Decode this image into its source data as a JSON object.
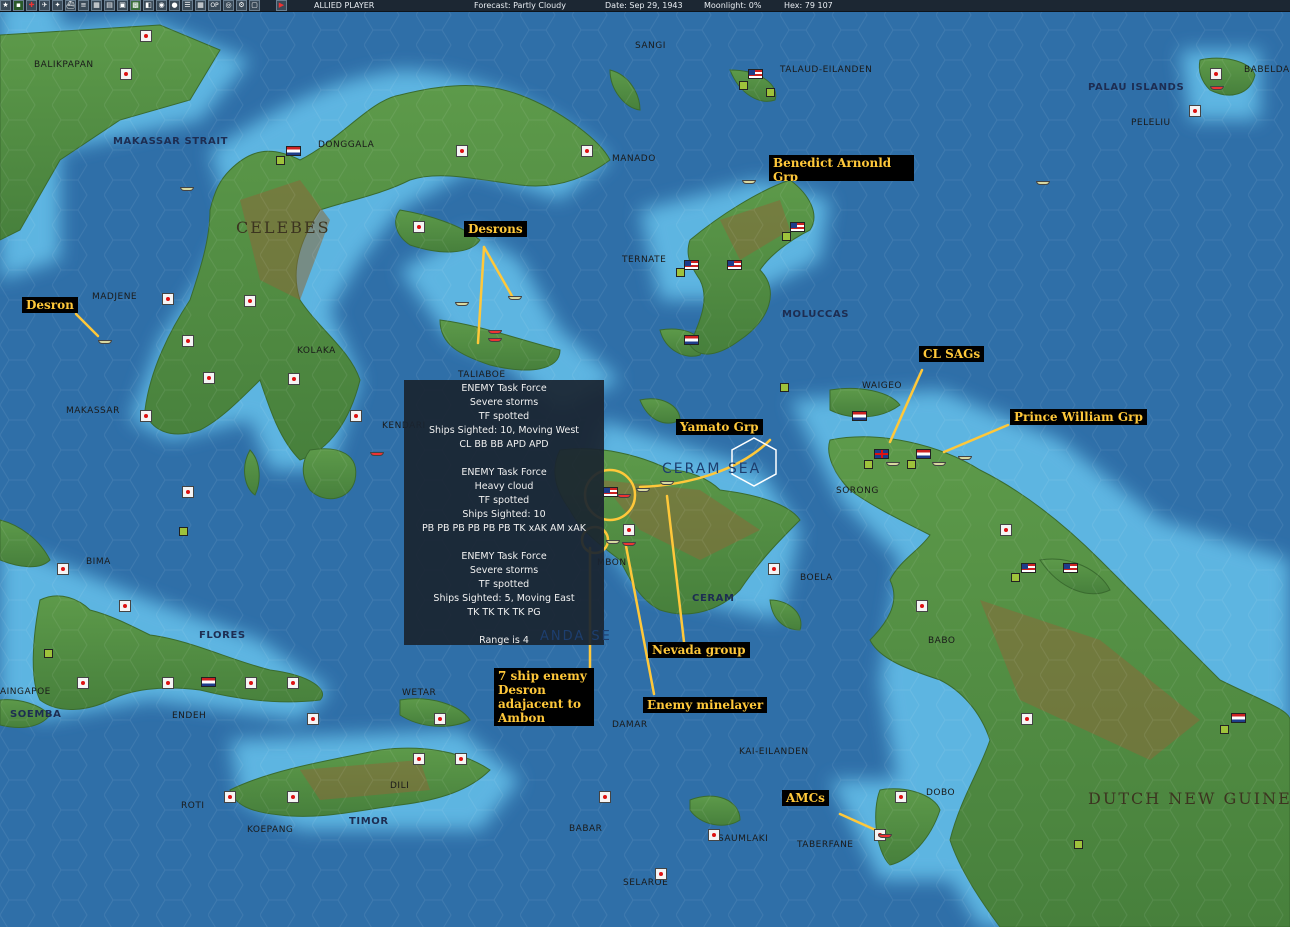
{
  "topbar": {
    "player": "ALLIED PLAYER",
    "forecast": "Forecast: Partly Cloudy",
    "date": "Date: Sep 29, 1943",
    "moonlight": "Moonlight: 0%",
    "hex": "Hex: 79 107",
    "button_op": "OP"
  },
  "map_labels": {
    "balikpapan": "BALIKPAPAN",
    "makassar_strait": "MAKASSAR STRAIT",
    "donggala": "DONGGALA",
    "sangi": "SANGI",
    "manado": "MANADO",
    "talaud": "TALAUD-EILANDEN",
    "palau": "PALAU ISLANDS",
    "babeldaob": "BABELDAC",
    "peleliu": "PELELIU",
    "celebes": "CELEBES",
    "madjene": "MADJENE",
    "ternate": "TERNATE",
    "moluccas": "MOLUCCAS",
    "kolaka": "KOLAKA",
    "taliaboe": "TALIABOE",
    "makassar": "MAKASSAR",
    "kendari": "KENDARI",
    "waigeo": "WAIGEO",
    "ceram_sea": "CERAM SEA",
    "sorong": "SORONG",
    "bima": "BIMA",
    "ambon": "MBON",
    "boela": "BOELA",
    "ceram": "CERAM",
    "flores": "FLORES",
    "babo": "BABO",
    "banda_sea": "ANDA SE",
    "waingapoe": "AINGAPOE",
    "soemba": "SOEMBA",
    "endeh": "ENDEH",
    "wetar": "WETAR",
    "damar": "DAMAR",
    "kai": "KAI-EILANDEN",
    "dili": "DILI",
    "roti": "ROTI",
    "timor": "TIMOR",
    "dobo": "DOBO",
    "dutch_new_guinea": "DUTCH NEW GUINEA",
    "koepang": "KOEPANG",
    "babar": "BABAR",
    "saumlaki": "SAUMLAKI",
    "taberfane": "TABERFANE",
    "selaroe": "SELAROE"
  },
  "annotations": {
    "benedict": "Benedict Arnonld Grp",
    "desrons": "Desrons",
    "desron": "Desron",
    "cl_sags": "CL SAGs",
    "prince_william": "Prince William Grp",
    "yamato": "Yamato Grp",
    "nevada": "Nevada group",
    "minelayer": "Enemy minelayer",
    "desron7": "7 ship enemy Desron adajacent to Ambon",
    "amcs": "AMCs"
  },
  "popup": {
    "lines": [
      "ENEMY Task Force",
      "Severe storms",
      "TF spotted",
      "Ships Sighted: 10, Moving West",
      "CL BB BB APD APD",
      "",
      "ENEMY Task Force",
      "Heavy cloud",
      "TF spotted",
      "Ships Sighted: 10",
      "PB PB PB PB PB PB TK xAK AM xAK",
      "",
      "ENEMY Task Force",
      "Severe storms",
      "TF spotted",
      "Ships Sighted: 5, Moving East",
      "TK TK TK TK PG",
      "",
      "Range is 4"
    ]
  },
  "colors": {
    "annotation_text": "#ffc83a",
    "annotation_bg": "#000000",
    "ocean": "#2f6fa8",
    "shallow_water": "#5ab0e0",
    "land": "#4f8a43",
    "mountain": "#8a6a3a"
  }
}
